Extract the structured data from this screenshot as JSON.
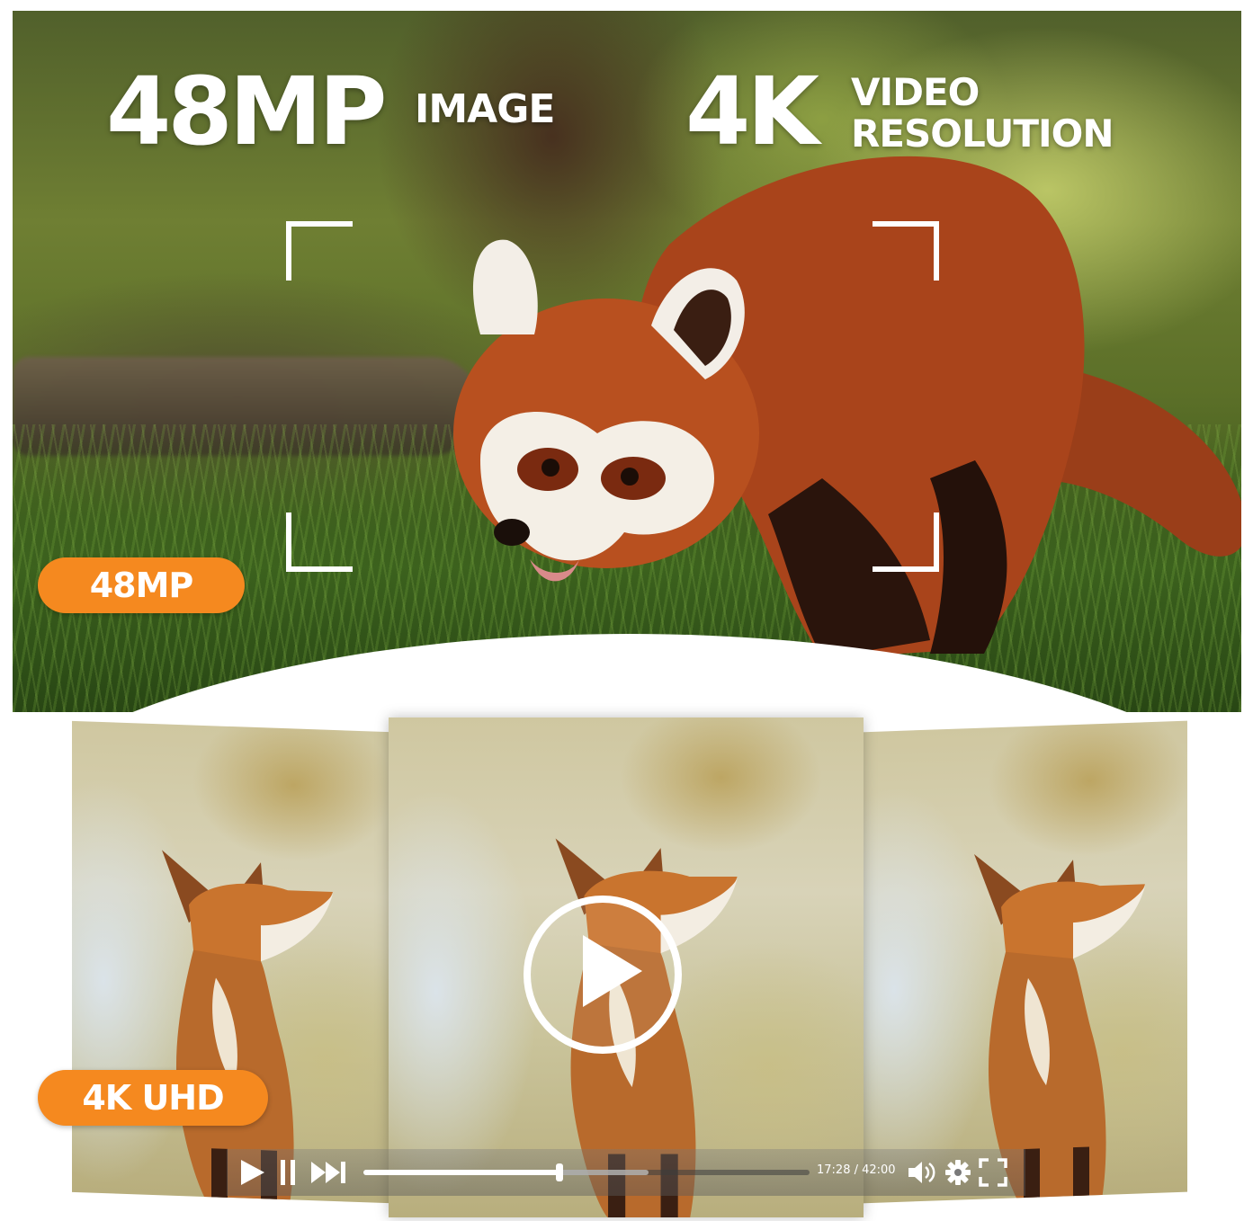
{
  "hero": {
    "headline_left_big": "48MP",
    "headline_left_small": "IMAGE",
    "headline_right_big": "4K",
    "headline_right_small_line1": "VIDEO",
    "headline_right_small_line2": "RESOLUTION",
    "badge": "48MP"
  },
  "video": {
    "badge": "4K UHD",
    "time": "17:28 / 42:00",
    "progress": 0.44,
    "buffered": 0.64,
    "icons": [
      "play-icon",
      "pause-icon",
      "skip-forward-icon",
      "volume-icon",
      "gear-icon",
      "fullscreen-icon",
      "play-circle-icon"
    ]
  },
  "colors": {
    "accent": "#f5891f",
    "text_on_image": "#ffffff"
  }
}
